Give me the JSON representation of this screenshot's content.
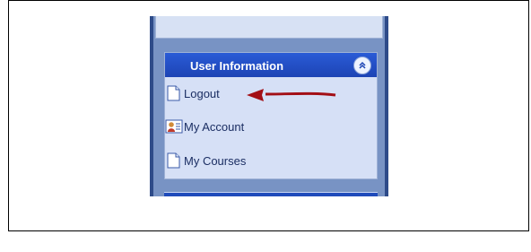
{
  "panel": {
    "title": "User Information",
    "items": [
      {
        "label": "Logout",
        "icon": "document-icon"
      },
      {
        "label": "My Account",
        "icon": "user-card-icon"
      },
      {
        "label": "My Courses",
        "icon": "document-icon"
      }
    ]
  },
  "colors": {
    "header_blue": "#1d44b5",
    "panel_bg": "#d6e0f6",
    "arrow_red": "#a30f16"
  }
}
